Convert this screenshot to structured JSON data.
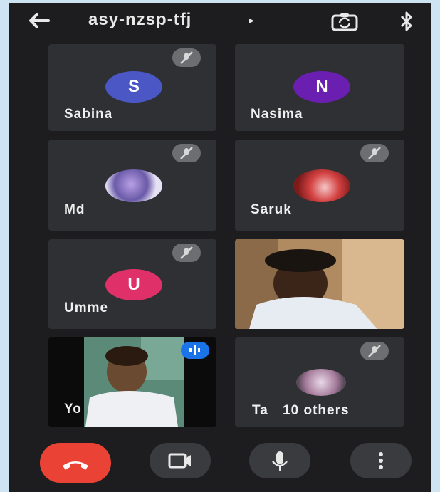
{
  "header": {
    "meeting_code": "asy-nzsp-tfj",
    "caret": "▸"
  },
  "participants": [
    {
      "name": "Sabina",
      "initial": "S",
      "avatar_color": "#4a57c5",
      "muted": true
    },
    {
      "name": "Nasima",
      "initial": "N",
      "avatar_color": "#6a1fb0",
      "muted": false
    },
    {
      "name": "Md",
      "initial": "",
      "muted": true
    },
    {
      "name": "Saruk",
      "initial": "",
      "muted": true
    },
    {
      "name": "Umme",
      "initial": "U",
      "avatar_color": "#e0306a",
      "muted": true
    },
    {
      "name": "",
      "initial": "",
      "muted": false
    },
    {
      "name": "Yo",
      "initial": "",
      "muted": false
    },
    {
      "name": "Ta",
      "others": "10 others",
      "muted": true
    }
  ],
  "colors": {
    "end_call": "#ea4335",
    "tile_bg": "#2f3033",
    "background": "#1d1d1f"
  },
  "controls": {
    "end_call": "phone-hangup-icon",
    "camera": "video-camera-icon",
    "mic": "microphone-icon",
    "more": "more-vertical-icon"
  }
}
